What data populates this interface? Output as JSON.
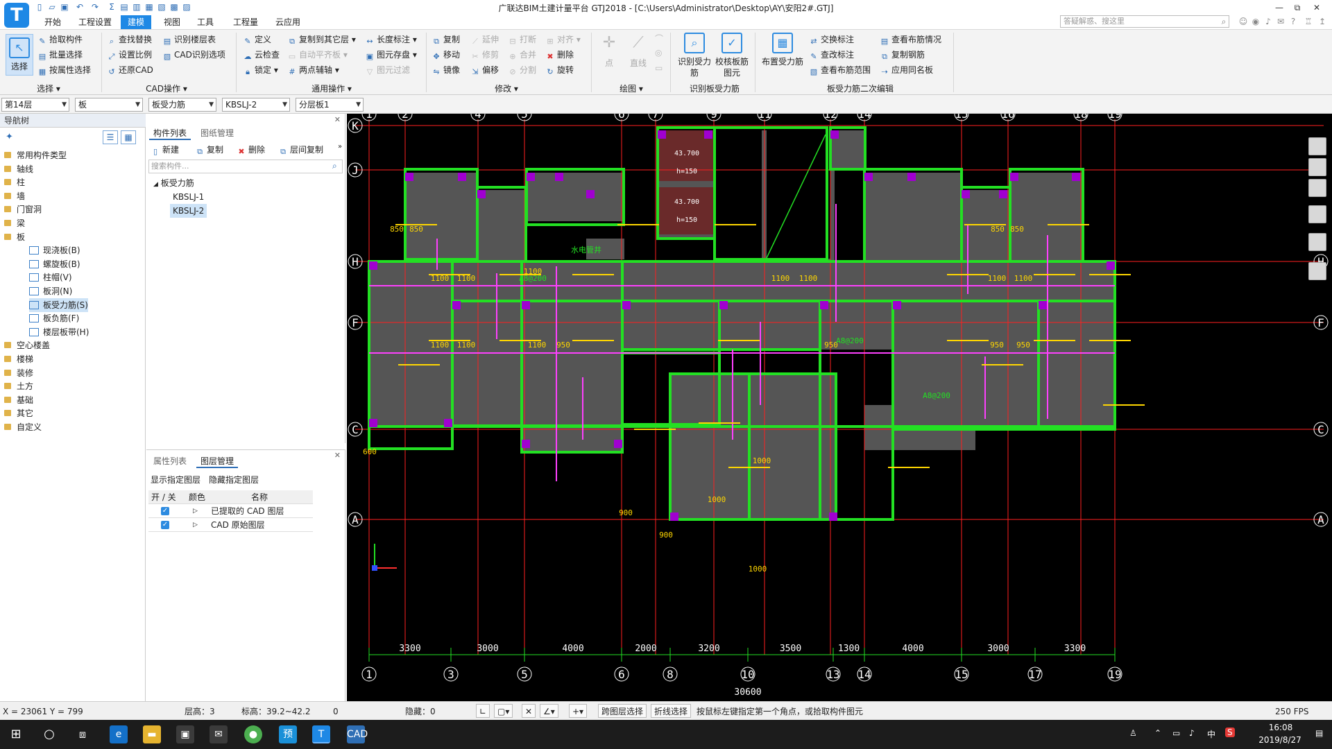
{
  "window": {
    "title": "广联达BIM土建计量平台 GTJ2018 - [C:\\Users\\Administrator\\Desktop\\AY\\安阳2#.GTJ]",
    "min": "—",
    "restore": "⧉",
    "close": "✕"
  },
  "app_logo": "T",
  "tabs": [
    "开始",
    "工程设置",
    "建模",
    "视图",
    "工具",
    "工程量",
    "云应用"
  ],
  "active_tab": "建模",
  "search": {
    "placeholder": "答疑解惑、搜这里"
  },
  "ribbon": {
    "select_group": {
      "label": "选择",
      "big": "选择",
      "items": [
        "拾取构件",
        "批量选择",
        "按属性选择"
      ]
    },
    "cad_group": {
      "label": "CAD操作",
      "items": [
        "查找替换",
        "识别楼层表",
        "设置比例",
        "CAD识别选项",
        "还原CAD"
      ]
    },
    "common_group": {
      "label": "通用操作",
      "items": [
        "定义",
        "复制到其它层",
        "长度标注",
        "云检查",
        "自动平齐板",
        "图元存盘",
        "锁定",
        "两点辅轴",
        "图元过滤"
      ]
    },
    "modify_group": {
      "label": "修改",
      "items": [
        "复制",
        "延伸",
        "打断",
        "对齐",
        "移动",
        "修剪",
        "合并",
        "删除",
        "镜像",
        "偏移",
        "分割",
        "旋转"
      ]
    },
    "draw_group": {
      "label": "绘图",
      "items": [
        "点",
        "直线"
      ]
    },
    "identify_group": {
      "label": "识别板受力筋",
      "items": [
        "识别受力筋",
        "校核板筋图元"
      ]
    },
    "edit_group": {
      "label": "板受力筋二次编辑",
      "big": "布置受力筋",
      "items": [
        "交换标注",
        "查看布筋情况",
        "查改标注",
        "复制钢筋",
        "查看布筋范围",
        "应用同名板"
      ]
    }
  },
  "selectors": [
    "第14层",
    "板",
    "板受力筋",
    "KBSLJ-2",
    "分层板1"
  ],
  "nav": {
    "header": "导航树",
    "nodes": [
      {
        "label": "常用构件类型",
        "type": "folder"
      },
      {
        "label": "轴线",
        "type": "folder"
      },
      {
        "label": "柱",
        "type": "folder"
      },
      {
        "label": "墙",
        "type": "folder"
      },
      {
        "label": "门窗洞",
        "type": "folder"
      },
      {
        "label": "梁",
        "type": "folder"
      },
      {
        "label": "板",
        "type": "folder"
      },
      {
        "label": "现浇板(B)",
        "type": "leaf"
      },
      {
        "label": "螺旋板(B)",
        "type": "leaf"
      },
      {
        "label": "柱帽(V)",
        "type": "leaf"
      },
      {
        "label": "板洞(N)",
        "type": "leaf"
      },
      {
        "label": "板受力筋(S)",
        "type": "leaf",
        "selected": true
      },
      {
        "label": "板负筋(F)",
        "type": "leaf"
      },
      {
        "label": "楼层板带(H)",
        "type": "leaf"
      },
      {
        "label": "空心楼盖",
        "type": "folder"
      },
      {
        "label": "楼梯",
        "type": "folder"
      },
      {
        "label": "装修",
        "type": "folder"
      },
      {
        "label": "土方",
        "type": "folder"
      },
      {
        "label": "基础",
        "type": "folder"
      },
      {
        "label": "其它",
        "type": "folder"
      },
      {
        "label": "自定义",
        "type": "folder"
      }
    ]
  },
  "comp_panel": {
    "tabs": [
      "构件列表",
      "图纸管理"
    ],
    "tools": [
      "新建",
      "复制",
      "删除",
      "层间复制"
    ],
    "search_placeholder": "搜索构件...",
    "group": "板受力筋",
    "items": [
      "KBSLJ-1",
      "KBSLJ-2"
    ]
  },
  "layer_panel": {
    "tabs": [
      "属性列表",
      "图层管理"
    ],
    "actions": [
      "显示指定图层",
      "隐藏指定图层"
    ],
    "columns": [
      "开 / 关",
      "颜色",
      "名称"
    ],
    "rows": [
      "已提取的 CAD 图层",
      "CAD 原始图层"
    ]
  },
  "drawing": {
    "top_axes": [
      "1",
      "2",
      "4",
      "5",
      "6",
      "7",
      "9",
      "11",
      "12",
      "14",
      "15",
      "16",
      "18",
      "19"
    ],
    "bottom_axes": [
      "1",
      "3",
      "5",
      "6",
      "8",
      "10",
      "13",
      "14",
      "15",
      "17",
      "19"
    ],
    "left_axes": [
      "K",
      "J",
      "H",
      "F",
      "C",
      "A"
    ],
    "right_axes": [
      "H",
      "F",
      "C",
      "A"
    ],
    "bottom_dims": [
      "3300",
      "3000",
      "4000",
      "2000",
      "3200",
      "3500",
      "1300",
      "4000",
      "3000",
      "3300"
    ],
    "bottom_total": "30600",
    "rebar_labels": [
      "850",
      "850",
      "850",
      "850",
      "1100",
      "1100",
      "1100",
      "1100",
      "1100",
      "1100",
      "1100",
      "1100",
      "1100",
      "1100",
      "950",
      "950",
      "950",
      "950",
      "600",
      "1000",
      "1000",
      "1000",
      "900",
      "900"
    ],
    "room_labels": [
      "水电管井",
      "A8@200",
      "A8@200",
      "A8@200"
    ],
    "elev_labels": [
      "43.700",
      "h=150",
      "43.700",
      "h=150"
    ],
    "colors": {
      "slab": "#555555",
      "wall": "#23e023",
      "rebar_y": "#ffd700",
      "rebar_m": "#ff40ff",
      "axis": "#ff2020",
      "column": "#a000d0"
    }
  },
  "status": {
    "coords": "X = 23061 Y = 799",
    "floor_height": "层高：3",
    "elevation": "标高：39.2~42.2",
    "zero": "0",
    "hidden": "隐藏：0",
    "btn_cross_layer": "跨图层选择",
    "btn_polyline": "折线选择",
    "hint": "按鼠标左键指定第一个角点，或拾取构件图元",
    "fps": "250 FPS"
  },
  "taskbar": {
    "time": "16:08",
    "date": "2019/8/27",
    "ime": "中"
  }
}
